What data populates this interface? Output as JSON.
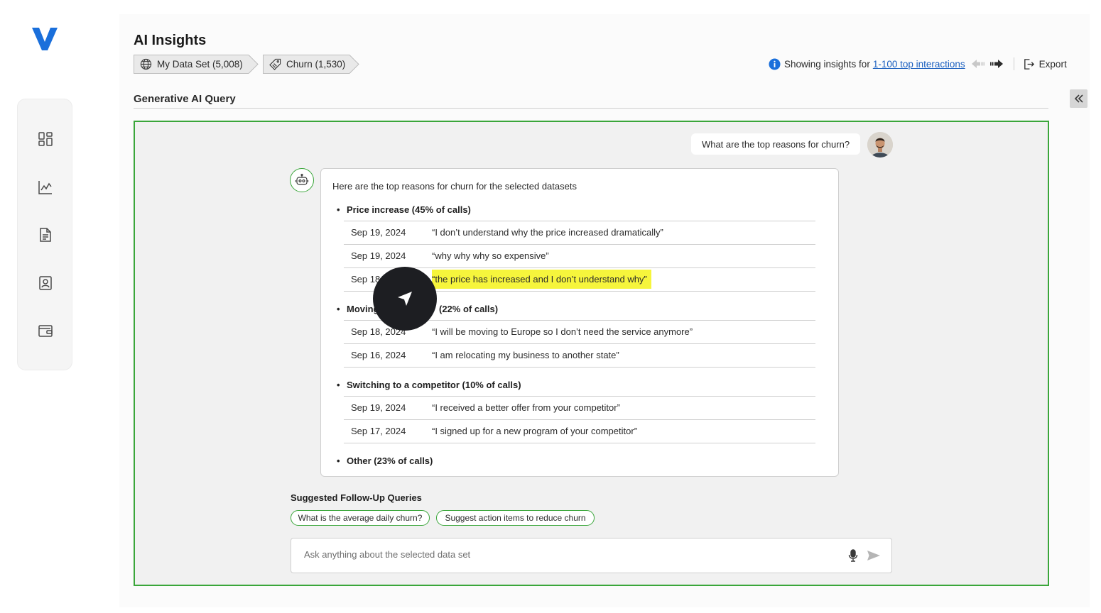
{
  "header": {
    "title": "AI Insights",
    "breadcrumbs": [
      {
        "label": "My Data Set (5,008)",
        "icon": "globe-icon"
      },
      {
        "label": "Churn (1,530)",
        "icon": "tag-icon"
      }
    ],
    "insights_prefix": "Showing insights for",
    "insights_link": "1-100 top interactions",
    "export_label": "Export"
  },
  "sidebar": {
    "items": [
      {
        "icon": "dashboard-icon"
      },
      {
        "icon": "chart-icon"
      },
      {
        "icon": "document-icon"
      },
      {
        "icon": "contact-icon"
      },
      {
        "icon": "wallet-icon"
      }
    ]
  },
  "section": {
    "title": "Generative AI Query"
  },
  "chat": {
    "user_message": "What are the top reasons for churn?",
    "intro": "Here are the top reasons for churn for the selected datasets",
    "groups": [
      {
        "title": "Price increase (45% of calls)",
        "rows": [
          {
            "date": "Sep 19, 2024",
            "quote": "“I don’t understand why the price increased dramatically”"
          },
          {
            "date": "Sep 19, 2024",
            "quote": "“why why why so expensive”"
          },
          {
            "date": "Sep 18",
            "quote": "“the price has increased and I don’t understand why”"
          }
        ]
      },
      {
        "title_prefix": "Moving",
        "title_suffix": "(22% of calls)",
        "rows": [
          {
            "date": "Sep 18, 2024",
            "quote": "“I will be moving to Europe so I don’t need the service anymore”"
          },
          {
            "date": "Sep 16, 2024",
            "quote": "“I am relocating my business to another state”"
          }
        ]
      },
      {
        "title": "Switching to a competitor (10% of calls)",
        "rows": [
          {
            "date": "Sep 19, 2024",
            "quote": "“I received a better offer from your competitor”"
          },
          {
            "date": "Sep 17, 2024",
            "quote": "“I signed up for a new program of your competitor”"
          }
        ]
      },
      {
        "title": "Other (23% of calls)",
        "rows": []
      }
    ]
  },
  "suggestions": {
    "title": "Suggested Follow-Up Queries",
    "chips": [
      "What is the average daily churn?",
      "Suggest action items to reduce churn"
    ]
  },
  "input": {
    "placeholder": "Ask anything about the selected data set"
  },
  "colors": {
    "accent_green": "#3aa63a",
    "link_blue": "#1a5fbf",
    "logo_blue": "#1a6fdb",
    "highlight_yellow": "#f6f53c"
  }
}
